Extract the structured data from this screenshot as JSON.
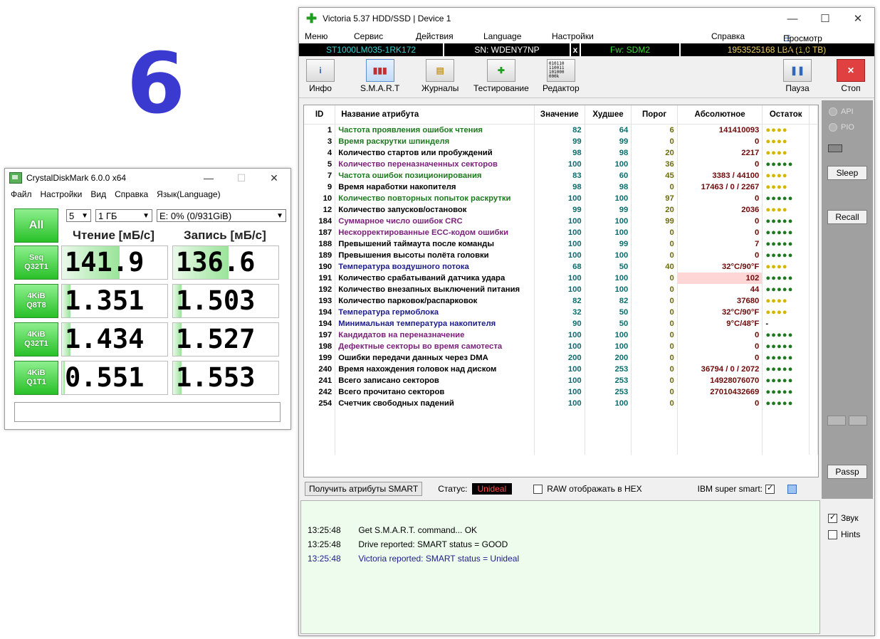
{
  "overlay_number": "6",
  "cdm": {
    "title": "CrystalDiskMark 6.0.0 x64",
    "menu": [
      "Файл",
      "Настройки",
      "Вид",
      "Справка",
      "Язык(Language)"
    ],
    "count": "5",
    "size": "1 ГБ",
    "drive": "E: 0% (0/931GiB)",
    "all_label": "All",
    "read_header": "Чтение [мБ/с]",
    "write_header": "Запись [мБ/с]",
    "rows": [
      {
        "line1": "Seq",
        "line2": "Q32T1",
        "read": "141.9",
        "write": "136.6",
        "read_fill": 0.55,
        "write_fill": 0.53
      },
      {
        "line1": "4KiB",
        "line2": "Q8T8",
        "read": "1.351",
        "write": "1.503",
        "read_fill": 0.08,
        "write_fill": 0.08
      },
      {
        "line1": "4KiB",
        "line2": "Q32T1",
        "read": "1.434",
        "write": "1.527",
        "read_fill": 0.08,
        "write_fill": 0.08
      },
      {
        "line1": "4KiB",
        "line2": "Q1T1",
        "read": "0.551",
        "write": "1.553",
        "read_fill": 0.03,
        "write_fill": 0.08
      }
    ]
  },
  "victoria": {
    "title": "Victoria 5.37 HDD/SSD | Device 1",
    "menu": [
      "Меню",
      "Сервис",
      "Действия",
      "Language",
      "Настройки",
      "Справка"
    ],
    "buffer_view": "Просмотр буфера",
    "info": {
      "model": "ST1000LM035-1RK172",
      "serial": "SN: WDENY7NP",
      "x": "x",
      "firmware": "Fw: SDM2",
      "lba": "1953525168 LBA (1,0 TB)"
    },
    "toolbar": {
      "info": "Инфо",
      "smart": "S.M.A.R.T",
      "journals": "Журналы",
      "testing": "Тестирование",
      "editor": "Редактор",
      "pause": "Пауза",
      "stop": "Стоп",
      "editor_icon_text": "010110 110011 101000 000k"
    },
    "columns": [
      "ID",
      "Название атрибута",
      "Значение",
      "Худшее",
      "Порог",
      "Абсолютное",
      "Остаток"
    ],
    "attributes": [
      {
        "id": "1",
        "name": "Частота проявления ошибок чтения",
        "color": "green",
        "value": "82",
        "worst": "64",
        "threshold": "6",
        "raw": "141410093",
        "rest": "●●●●",
        "rest_color": "gold"
      },
      {
        "id": "3",
        "name": "Время раскрутки шпинделя",
        "color": "green",
        "value": "99",
        "worst": "99",
        "threshold": "0",
        "raw": "0",
        "rest": "●●●●",
        "rest_color": "gold"
      },
      {
        "id": "4",
        "name": "Количество стартов или пробуждений",
        "color": "black",
        "value": "98",
        "worst": "98",
        "threshold": "20",
        "raw": "2217",
        "rest": "●●●●",
        "rest_color": "gold"
      },
      {
        "id": "5",
        "name": "Количество переназначенных секторов",
        "color": "purple",
        "value": "100",
        "worst": "100",
        "threshold": "36",
        "raw": "0",
        "rest": "●●●●●",
        "rest_color": "green"
      },
      {
        "id": "7",
        "name": "Частота ошибок позиционирования",
        "color": "green",
        "value": "83",
        "worst": "60",
        "threshold": "45",
        "raw": "3383 / 44100",
        "rest": "●●●●",
        "rest_color": "gold"
      },
      {
        "id": "9",
        "name": "Время наработки накопителя",
        "color": "black",
        "value": "98",
        "worst": "98",
        "threshold": "0",
        "raw": "17463 / 0 / 2267",
        "rest": "●●●●",
        "rest_color": "gold"
      },
      {
        "id": "10",
        "name": "Количество повторных попыток раскрутки",
        "color": "green",
        "value": "100",
        "worst": "100",
        "threshold": "97",
        "raw": "0",
        "rest": "●●●●●",
        "rest_color": "green"
      },
      {
        "id": "12",
        "name": "Количество запусков/остановок",
        "color": "black",
        "value": "99",
        "worst": "99",
        "threshold": "20",
        "raw": "2036",
        "rest": "●●●●",
        "rest_color": "gold"
      },
      {
        "id": "184",
        "name": "Суммарное число ошибок CRC",
        "color": "purple",
        "value": "100",
        "worst": "100",
        "threshold": "99",
        "raw": "0",
        "rest": "●●●●●",
        "rest_color": "green"
      },
      {
        "id": "187",
        "name": "Нескорректированные ECC-кодом ошибки",
        "color": "purple",
        "value": "100",
        "worst": "100",
        "threshold": "0",
        "raw": "0",
        "rest": "●●●●●",
        "rest_color": "green"
      },
      {
        "id": "188",
        "name": "Превышений таймаута после команды",
        "color": "black",
        "value": "100",
        "worst": "99",
        "threshold": "0",
        "raw": "7",
        "rest": "●●●●●",
        "rest_color": "green"
      },
      {
        "id": "189",
        "name": "Превышения высоты полёта головки",
        "color": "black",
        "value": "100",
        "worst": "100",
        "threshold": "0",
        "raw": "0",
        "rest": "●●●●●",
        "rest_color": "green"
      },
      {
        "id": "190",
        "name": "Температура воздушного потока",
        "color": "navy",
        "value": "68",
        "worst": "50",
        "threshold": "40",
        "raw": "32°C/90°F",
        "rest": "●●●●",
        "rest_color": "gold"
      },
      {
        "id": "191",
        "name": "Количество срабатываний датчика удара",
        "color": "black",
        "value": "100",
        "worst": "100",
        "threshold": "0",
        "raw": "102",
        "rest": "●●●●●",
        "rest_color": "green",
        "highlight": true
      },
      {
        "id": "192",
        "name": "Количество внезапных выключений питания",
        "color": "black",
        "value": "100",
        "worst": "100",
        "threshold": "0",
        "raw": "44",
        "rest": "●●●●●",
        "rest_color": "green"
      },
      {
        "id": "193",
        "name": "Количество парковок/распарковок",
        "color": "black",
        "value": "82",
        "worst": "82",
        "threshold": "0",
        "raw": "37680",
        "rest": "●●●●",
        "rest_color": "gold"
      },
      {
        "id": "194",
        "name": "Температура гермоблока",
        "color": "navy",
        "value": "32",
        "worst": "50",
        "threshold": "0",
        "raw": "32°C/90°F",
        "rest": "●●●●",
        "rest_color": "gold"
      },
      {
        "id": "194",
        "name": "Минимальная температура накопителя",
        "color": "navy",
        "value": "90",
        "worst": "50",
        "threshold": "0",
        "raw": "9°C/48°F",
        "rest": "-",
        "rest_color": "black"
      },
      {
        "id": "197",
        "name": "Кандидатов на переназначение",
        "color": "purple",
        "value": "100",
        "worst": "100",
        "threshold": "0",
        "raw": "0",
        "rest": "●●●●●",
        "rest_color": "green"
      },
      {
        "id": "198",
        "name": "Дефектные секторы во время самотеста",
        "color": "purple",
        "value": "100",
        "worst": "100",
        "threshold": "0",
        "raw": "0",
        "rest": "●●●●●",
        "rest_color": "green"
      },
      {
        "id": "199",
        "name": "Ошибки передачи данных через DMA",
        "color": "black",
        "value": "200",
        "worst": "200",
        "threshold": "0",
        "raw": "0",
        "rest": "●●●●●",
        "rest_color": "green"
      },
      {
        "id": "240",
        "name": "Время нахождения головок над диском",
        "color": "black",
        "value": "100",
        "worst": "253",
        "threshold": "0",
        "raw": "36794 / 0 / 2072",
        "rest": "●●●●●",
        "rest_color": "green"
      },
      {
        "id": "241",
        "name": "Всего записано секторов",
        "color": "black",
        "value": "100",
        "worst": "253",
        "threshold": "0",
        "raw": "14928076070",
        "rest": "●●●●●",
        "rest_color": "green"
      },
      {
        "id": "242",
        "name": "Всего прочитано секторов",
        "color": "black",
        "value": "100",
        "worst": "253",
        "threshold": "0",
        "raw": "27010432669",
        "rest": "●●●●●",
        "rest_color": "green"
      },
      {
        "id": "254",
        "name": "Счетчик свободных падений",
        "color": "black",
        "value": "100",
        "worst": "100",
        "threshold": "0",
        "raw": "0",
        "rest": "●●●●●",
        "rest_color": "green"
      }
    ],
    "status": {
      "get_smart": "Получить атрибуты SMART",
      "status_label": "Статус:",
      "status_value": "Unideal",
      "raw_hex": "RAW отображать в HEX",
      "ibm": "IBM super smart:"
    },
    "right_panel": {
      "api": "API",
      "pio": "PIO",
      "sleep": "Sleep",
      "recall": "Recall",
      "passp": "Passp",
      "sound": "Звук",
      "hints": "Hints"
    },
    "log": [
      {
        "time": "13:25:48",
        "text": "Get S.M.A.R.T. command... OK",
        "color": "black"
      },
      {
        "time": "13:25:48",
        "text": "Drive reported: SMART status = GOOD",
        "color": "black"
      },
      {
        "time": "13:25:48",
        "text": "Victoria reported: SMART status = Unideal",
        "color": "navy"
      }
    ]
  }
}
